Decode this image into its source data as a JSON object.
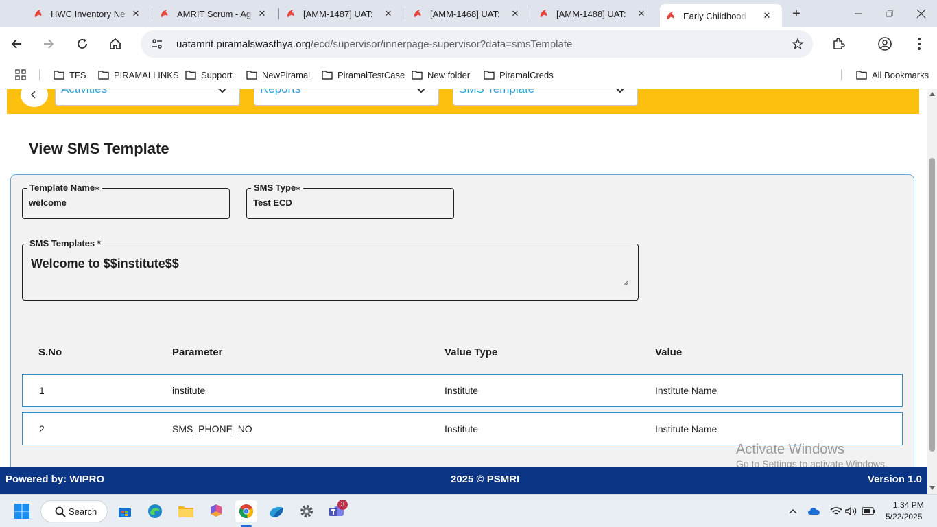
{
  "browser": {
    "tabs": [
      {
        "title": "HWC Inventory Ne",
        "active": false
      },
      {
        "title": "AMRIT Scrum - Ag",
        "active": false
      },
      {
        "title": "[AMM-1487] UAT:",
        "active": false
      },
      {
        "title": "[AMM-1468] UAT:",
        "active": false
      },
      {
        "title": "[AMM-1488] UAT:",
        "active": false
      },
      {
        "title": "Early Childhood D",
        "active": true
      }
    ],
    "url_host": "uatamrit.piramalswasthya.org",
    "url_path": "/ecd/supervisor/innerpage-supervisor?data=smsTemplate",
    "bookmarks": [
      "TFS",
      "PIRAMALLINKS",
      "Support",
      "NewPiramal",
      "PiramalTestCase",
      "New folder",
      "PiramalCreds"
    ],
    "all_bookmarks": "All Bookmarks"
  },
  "nav": {
    "activities": "Activities",
    "reports": "Reports",
    "sms_template": "SMS Template"
  },
  "page": {
    "title": "View SMS Template",
    "template_name_label": "Template Name",
    "template_name_value": "welcome",
    "sms_type_label": "SMS Type",
    "sms_type_value": "Test ECD",
    "sms_templates_label": "SMS Templates *",
    "sms_templates_value": "Welcome to $$institute$$",
    "table": {
      "headers": [
        "S.No",
        "Parameter",
        "Value Type",
        "Value"
      ],
      "rows": [
        [
          "1",
          "institute",
          "Institute",
          "Institute Name"
        ],
        [
          "2",
          "SMS_PHONE_NO",
          "Institute",
          "Institute Name"
        ]
      ]
    }
  },
  "watermark": {
    "line1": "Activate Windows",
    "line2": "Go to Settings to activate Windows."
  },
  "footer": {
    "left": "Powered by: WIPRO",
    "center": "2025 © PSMRI",
    "right": "Version 1.0"
  },
  "taskbar": {
    "search": "Search",
    "teams_badge": "3",
    "time": "1:34 PM",
    "date": "5/22/2025"
  },
  "colors": {
    "yellow": "#fec00f",
    "footer_blue": "#0b3585",
    "link_blue": "#29a3e0",
    "row_border": "#2f8fc2"
  }
}
